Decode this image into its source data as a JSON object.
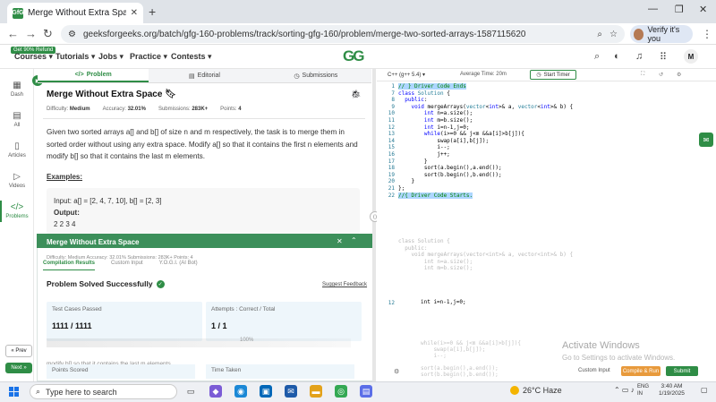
{
  "browser": {
    "tab_title": "Merge Without Extra Space | Pr",
    "tab_favicon": "GfG",
    "url": "geeksforgeeks.org/batch/gfg-160-problems/track/sorting-gfg-160/problem/merge-two-sorted-arrays-1587115620",
    "profile_label": "Verify it's you"
  },
  "site": {
    "refund_badge": "Get 90% Refund",
    "nav": [
      "Courses",
      "Tutorials",
      "Jobs",
      "Practice",
      "Contests"
    ],
    "logo": "GG",
    "avatar": "M"
  },
  "rail": {
    "items": [
      {
        "label": "Dash",
        "icon": "▦"
      },
      {
        "label": "All",
        "icon": "▤"
      },
      {
        "label": "Articles",
        "icon": "▯"
      },
      {
        "label": "Videos",
        "icon": "▷"
      },
      {
        "label": "Problems",
        "icon": "</>"
      }
    ],
    "prev_label": "« Prev",
    "next_label": "Next »"
  },
  "problem": {
    "tabs": [
      "Problem",
      "Editorial",
      "Submissions"
    ],
    "title": "Merge Without Extra Space",
    "meta": {
      "difficulty_label": "Difficulty:",
      "difficulty": "Medium",
      "accuracy_label": "Accuracy:",
      "accuracy": "32.01%",
      "submissions_label": "Submissions:",
      "submissions": "283K+",
      "points_label": "Points:",
      "points": "4"
    },
    "statement": "Given two sorted arrays a[] and b[] of size n and m respectively, the task is to merge them in sorted order without using any extra space. Modify a[] so that it contains the first n elements and modify b[] so that it contains the last m elements.",
    "examples_heading": "Examples:",
    "example_input": "Input: a[] = [2, 4, 7, 10], b[] = [2, 3]",
    "example_output_label": "Output:",
    "example_output": "2 2 3 4"
  },
  "result": {
    "ghost_title": "Merge Without Extra Space",
    "ghost_meta": "Difficulty: Medium   Accuracy: 32.01%   Submissions: 283K+   Points: 4",
    "tabs": [
      "Compilation Results",
      "Custom Input",
      "Y.O.G.I. (AI Bot)"
    ],
    "headline": "Problem Solved Successfully",
    "feedback": "Suggest Feedback",
    "test_cases_label": "Test Cases Passed",
    "test_cases_value": "1111 / 1111",
    "attempts_label": "Attempts : Correct / Total",
    "attempts_value": "1 / 1",
    "ghost_progress": "100%",
    "overlap_text": "modify b[] so that it contains the last m elements.",
    "points_scored_label": "Points Scored",
    "time_taken_label": "Time Taken"
  },
  "editor": {
    "language": "C++ (g++ 5.4)",
    "avg_time": "Average Time: 20m",
    "timer_label": "Start Timer",
    "custom_input_label": "Custom Input",
    "compile_label": "Compile & Run",
    "submit_label": "Submit",
    "line_numbers": [
      "1",
      "7",
      "8",
      "9",
      "10",
      "11",
      "12",
      "13",
      "14",
      "15",
      "16",
      "17",
      "18",
      "19",
      "20",
      "21",
      "22"
    ],
    "ghost_line_number": "12",
    "ghost_code": "int i=n-1,j=0;"
  },
  "watermark": {
    "title": "Activate Windows",
    "subtitle": "Go to Settings to activate Windows."
  },
  "taskbar": {
    "search_placeholder": "Type here to search",
    "weather": "26°C  Haze",
    "lang_line1": "ENG",
    "lang_line2": "IN",
    "time": "3:40 AM",
    "date": "1/19/2025"
  }
}
